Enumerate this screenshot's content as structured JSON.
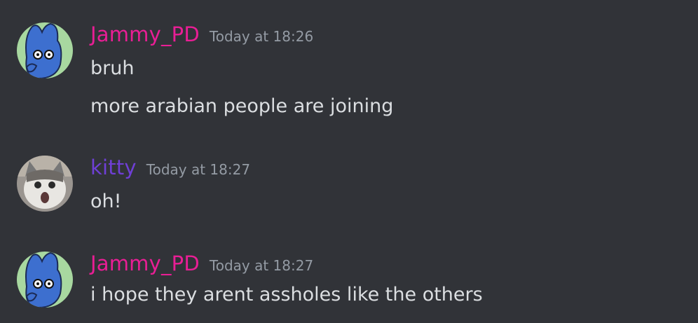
{
  "colors": {
    "background": "#313338",
    "jammy_name": "#e91e95",
    "kitty_name": "#6f3fd6",
    "timestamp": "#949ba4",
    "message_text": "#dbdee1"
  },
  "messages": [
    {
      "username": "Jammy_PD",
      "timestamp": "Today at 18:26",
      "avatar_icon": "blue-creature-avatar-icon",
      "lines": [
        "bruh",
        "more arabian people are joining"
      ]
    },
    {
      "username": "kitty",
      "timestamp": "Today at 18:27",
      "avatar_icon": "surprised-cat-avatar-icon",
      "lines": [
        "oh!"
      ]
    },
    {
      "username": "Jammy_PD",
      "timestamp": "Today at 18:27",
      "avatar_icon": "blue-creature-avatar-icon",
      "lines": [
        "i hope they arent assholes like the others"
      ]
    }
  ]
}
